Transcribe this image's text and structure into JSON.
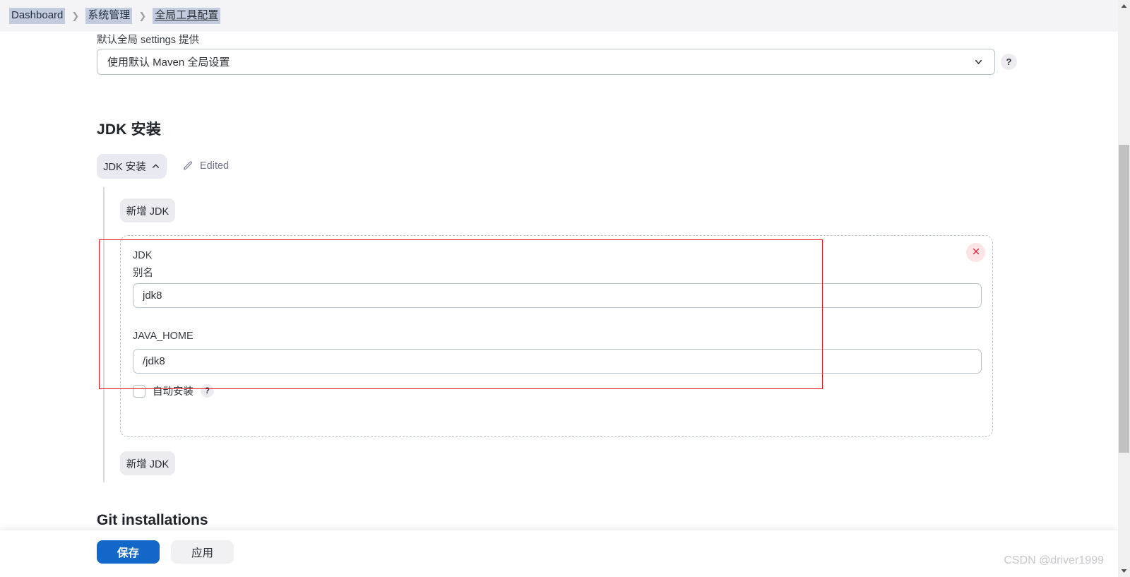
{
  "breadcrumb": {
    "items": [
      {
        "label": "Dashboard",
        "current": false
      },
      {
        "label": "系统管理",
        "current": false
      },
      {
        "label": "全局工具配置",
        "current": true
      }
    ],
    "separator": "❯",
    "highlight_color": "#c3ccdf"
  },
  "maven_settings": {
    "label": "默认全局 settings 提供",
    "selected_option": "使用默认 Maven 全局设置",
    "chevron_icon": "chevron-down-icon",
    "help_label": "?"
  },
  "jdk_section": {
    "title": "JDK 安装",
    "toggle_button": {
      "label": "JDK 安装",
      "chevron_icon": "chevron-up-icon"
    },
    "edited_status": {
      "icon": "pencil-icon",
      "label": "Edited"
    },
    "add_button_top": "新增 JDK",
    "add_button_bottom": "新增 JDK",
    "entry": {
      "type_label": "JDK",
      "alias_label": "别名",
      "alias_value": "jdk8",
      "java_home_label": "JAVA_HOME",
      "java_home_value": "/jdk8",
      "delete_icon": "close-icon",
      "auto_install": {
        "label": "自动安装",
        "checked": false,
        "help_label": "?"
      }
    }
  },
  "git_section": {
    "title": "Git installations"
  },
  "footer": {
    "save_label": "保存",
    "apply_label": "应用",
    "save_color": "#1267c8"
  },
  "watermark": {
    "text": "CSDN @driver1999"
  },
  "scrollbar": {
    "up_icon": "triangle-up-icon",
    "down_icon": "triangle-down-icon",
    "thumb_name": "scroll-thumb"
  }
}
